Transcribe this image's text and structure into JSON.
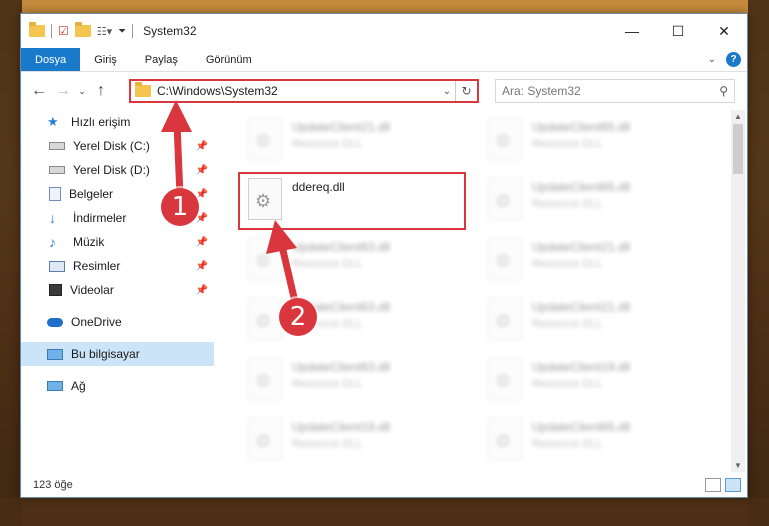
{
  "window": {
    "title": "System32",
    "controls": {
      "minimize": "—",
      "maximize": "☐",
      "close": "✕"
    }
  },
  "ribbon": {
    "tabs": [
      {
        "label": "Dosya",
        "active": true
      },
      {
        "label": "Giriş"
      },
      {
        "label": "Paylaş"
      },
      {
        "label": "Görünüm"
      }
    ],
    "expand_icon": "chevron-down-icon",
    "help": "?"
  },
  "address": {
    "path": "C:\\Windows\\System32",
    "search_placeholder": "Ara: System32"
  },
  "nav": {
    "quick_access": "Hızlı erişim",
    "items": [
      {
        "label": "Yerel Disk (C:)",
        "icon": "drive-icon"
      },
      {
        "label": "Yerel Disk (D:)",
        "icon": "drive-icon"
      },
      {
        "label": "Belgeler",
        "icon": "documents-icon"
      },
      {
        "label": "İndirmeler",
        "icon": "downloads-icon"
      },
      {
        "label": "Müzik",
        "icon": "music-icon"
      },
      {
        "label": "Resimler",
        "icon": "pictures-icon"
      },
      {
        "label": "Videolar",
        "icon": "videos-icon"
      }
    ],
    "onedrive": "OneDrive",
    "this_pc": "Bu bilgisayar",
    "network": "Ağ"
  },
  "files": {
    "left": [
      {
        "name": "UpdateClient21.dll",
        "type": "Resource DLL"
      },
      {
        "name": "ddereq.dll",
        "type": ""
      },
      {
        "name": "UpdateClient63.dll",
        "type": "Resource DLL"
      },
      {
        "name": "UpdateClient63.dll",
        "type": "Resource DLL"
      },
      {
        "name": "UpdateClient63.dll",
        "type": "Resource DLL"
      },
      {
        "name": "UpdateClient19.dll",
        "type": "Resource DLL"
      }
    ],
    "right": [
      {
        "name": "UpdateClient65.dll",
        "type": "Resource DLL"
      },
      {
        "name": "UpdateClient65.dll",
        "type": "Resource DLL"
      },
      {
        "name": "UpdateClient21.dll",
        "type": "Resource DLL"
      },
      {
        "name": "UpdateClient21.dll",
        "type": "Resource DLL"
      },
      {
        "name": "UpdateClient19.dll",
        "type": "Resource DLL"
      },
      {
        "name": "UpdateClient65.dll",
        "type": "Resource DLL"
      }
    ]
  },
  "status": {
    "count": "123 öğe"
  },
  "annotations": {
    "step1": "1",
    "step2": "2"
  },
  "colors": {
    "accent": "#1979ca",
    "highlight": "#d9363e",
    "selection": "#cce4f7"
  }
}
